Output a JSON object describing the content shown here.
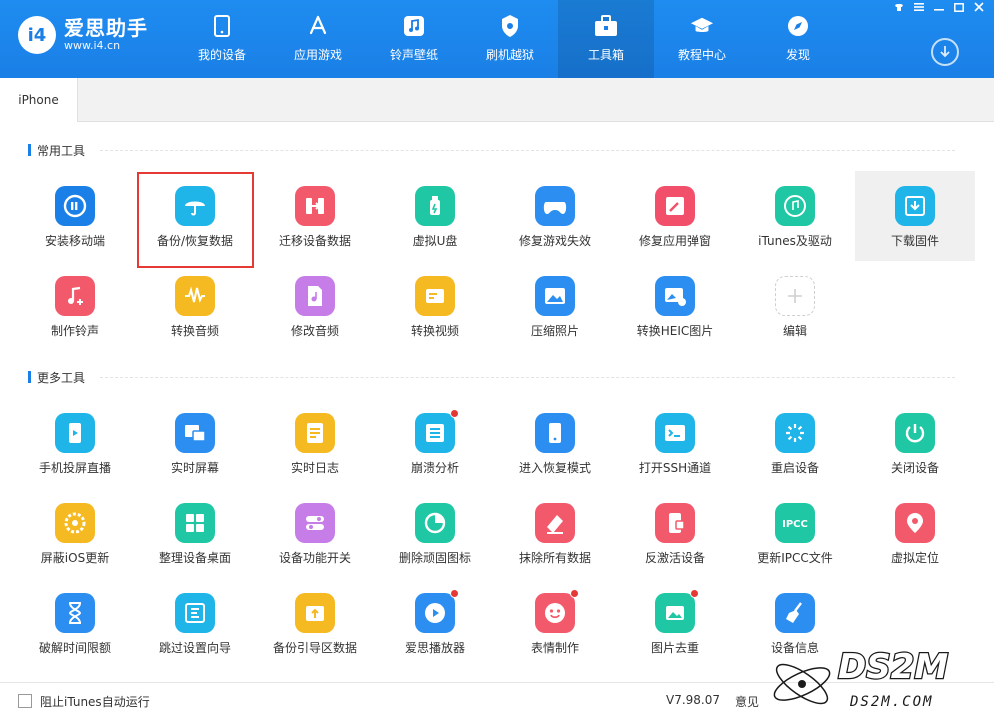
{
  "app": {
    "name": "爱思助手",
    "url": "www.i4.cn",
    "logo_mark": "i4"
  },
  "nav": [
    {
      "label": "我的设备",
      "icon": "phone-icon"
    },
    {
      "label": "应用游戏",
      "icon": "app-store-icon"
    },
    {
      "label": "铃声壁纸",
      "icon": "music-icon"
    },
    {
      "label": "刷机越狱",
      "icon": "jailbreak-icon"
    },
    {
      "label": "工具箱",
      "icon": "toolbox-icon",
      "active": true
    },
    {
      "label": "教程中心",
      "icon": "graduation-cap-icon"
    },
    {
      "label": "发现",
      "icon": "compass-icon"
    }
  ],
  "window_controls": [
    "skin-icon",
    "menu-icon",
    "minimize-icon",
    "maximize-icon",
    "close-icon"
  ],
  "tabs": [
    {
      "label": "iPhone"
    }
  ],
  "sections": {
    "common": {
      "title": "常用工具",
      "tools": [
        {
          "label": "安装移动端",
          "icon": "i4-app-icon",
          "color": "#1a7fe6"
        },
        {
          "label": "备份/恢复数据",
          "icon": "umbrella-icon",
          "color": "#1fb5e8",
          "selected": true
        },
        {
          "label": "迁移设备数据",
          "icon": "transfer-icon",
          "color": "#f25a6b"
        },
        {
          "label": "虚拟U盘",
          "icon": "usb-drive-icon",
          "color": "#1fc7a5"
        },
        {
          "label": "修复游戏失效",
          "icon": "gamepad-icon",
          "color": "#2b8ef0"
        },
        {
          "label": "修复应用弹窗",
          "icon": "wrench-icon",
          "color": "#f2506a"
        },
        {
          "label": "iTunes及驱动",
          "icon": "itunes-icon",
          "color": "#1fc7a5"
        },
        {
          "label": "下载固件",
          "icon": "download-box-icon",
          "color": "#1fb5e8",
          "hover": true
        },
        {
          "label": "制作铃声",
          "icon": "music-note-plus-icon",
          "color": "#f25a6b"
        },
        {
          "label": "转换音频",
          "icon": "waveform-icon",
          "color": "#f5b921"
        },
        {
          "label": "修改音频",
          "icon": "audio-file-icon",
          "color": "#c77de8"
        },
        {
          "label": "转换视频",
          "icon": "video-convert-icon",
          "color": "#f5b921"
        },
        {
          "label": "压缩照片",
          "icon": "image-icon",
          "color": "#2b8ef0"
        },
        {
          "label": "转换HEIC图片",
          "icon": "image-convert-icon",
          "color": "#2b8ef0"
        },
        {
          "label": "编辑",
          "icon": "plus-icon",
          "color": "#cfcfcf",
          "add": true
        }
      ]
    },
    "more": {
      "title": "更多工具",
      "tools": [
        {
          "label": "手机投屏直播",
          "icon": "cast-icon",
          "color": "#1fb5e8"
        },
        {
          "label": "实时屏幕",
          "icon": "screen-icon",
          "color": "#2b8ef0"
        },
        {
          "label": "实时日志",
          "icon": "log-icon",
          "color": "#f5b921"
        },
        {
          "label": "崩溃分析",
          "icon": "crash-report-icon",
          "color": "#1fb5e8",
          "badge": true
        },
        {
          "label": "进入恢复模式",
          "icon": "recovery-mode-icon",
          "color": "#2b8ef0"
        },
        {
          "label": "打开SSH通道",
          "icon": "terminal-icon",
          "color": "#1fb5e8"
        },
        {
          "label": "重启设备",
          "icon": "restart-icon",
          "color": "#1fb5e8"
        },
        {
          "label": "关闭设备",
          "icon": "power-icon",
          "color": "#1fc7a5"
        },
        {
          "label": "屏蔽iOS更新",
          "icon": "block-update-icon",
          "color": "#f5b921"
        },
        {
          "label": "整理设备桌面",
          "icon": "grid-icon",
          "color": "#1fc7a5"
        },
        {
          "label": "设备功能开关",
          "icon": "toggle-icon",
          "color": "#c77de8"
        },
        {
          "label": "删除顽固图标",
          "icon": "pie-icon",
          "color": "#1fc7a5"
        },
        {
          "label": "抹除所有数据",
          "icon": "eraser-icon",
          "color": "#f25a6b"
        },
        {
          "label": "反激活设备",
          "icon": "deactivate-icon",
          "color": "#f25a6b"
        },
        {
          "label": "更新IPCC文件",
          "icon": "ipcc-icon",
          "color": "#1fc7a5",
          "text": "IPCC"
        },
        {
          "label": "虚拟定位",
          "icon": "location-pin-icon",
          "color": "#f25a6b"
        },
        {
          "label": "破解时间限额",
          "icon": "hourglass-icon",
          "color": "#2b8ef0"
        },
        {
          "label": "跳过设置向导",
          "icon": "skip-guide-icon",
          "color": "#1fb5e8"
        },
        {
          "label": "备份引导区数据",
          "icon": "backup-boot-icon",
          "color": "#f5b921"
        },
        {
          "label": "爱思播放器",
          "icon": "play-icon",
          "color": "#2b8ef0",
          "badge": true
        },
        {
          "label": "表情制作",
          "icon": "smiley-icon",
          "color": "#f25a6b",
          "badge": true
        },
        {
          "label": "图片去重",
          "icon": "photo-dedupe-icon",
          "color": "#1fc7a5",
          "badge": true
        },
        {
          "label": "设备信息",
          "icon": "broom-icon",
          "color": "#2b8ef0"
        }
      ]
    }
  },
  "footer": {
    "block_itunes_label": "阻止iTunes自动运行",
    "version": "V7.98.07",
    "feedback": "意见"
  },
  "watermark": {
    "text": "DS2M",
    "url": "DS2M.COM"
  }
}
